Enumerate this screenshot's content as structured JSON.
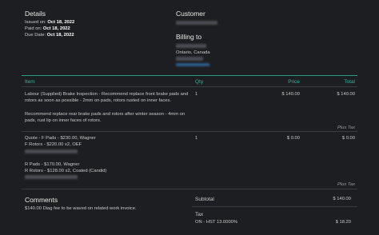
{
  "details": {
    "title": "Details",
    "issued_label": "Issued on:",
    "issued_value": "Oct 18, 2022",
    "paid_label": "Paid on:",
    "paid_value": "Oct 18, 2022",
    "due_label": "Due Date:",
    "due_value": "Oct 18, 2022"
  },
  "customer": {
    "title": "Customer"
  },
  "billing": {
    "title": "Billing to",
    "region": "Ontario, Canada"
  },
  "table": {
    "headers": {
      "item": "Item",
      "qty": "Qty",
      "price": "Price",
      "total": "Total"
    },
    "rows": [
      {
        "line1": "Labour (Supplied) Brake Inspection - Recommend replace front brake pads and",
        "line2": "rotors as soon as possible - 2mm on pads, rotors rusted on inner faces.",
        "line3": "Recommend replace rear brake pads and rotors after winter season - 4mm on",
        "line4": "pads, rust lip on inner faces of rotors.",
        "qty": "1",
        "price": "$ 140.00",
        "total": "$ 140.00",
        "tax": "Plus Tax"
      },
      {
        "line1": "Quote - F Pads - $230.00, Wagner",
        "line2": "F Rotors - $220.00 x2, OEF",
        "line3": "R Pads - $170.00, Wagner",
        "line4": "R Rotors - $128.00 x2, Coated (Candid)",
        "qty": "1",
        "price": "$ 0.00",
        "total": "$ 0.00",
        "tax": "Plus Tax"
      }
    ]
  },
  "comments": {
    "title": "Comments",
    "text": "$140.00 Diag fee to be waved on related work invoice."
  },
  "summary": {
    "subtotal_label": "Subtotal",
    "subtotal_value": "$ 140.00",
    "tax_title": "Tax",
    "tax_label": "ON - HST 13.0000%",
    "tax_value": "$ 18.20"
  }
}
